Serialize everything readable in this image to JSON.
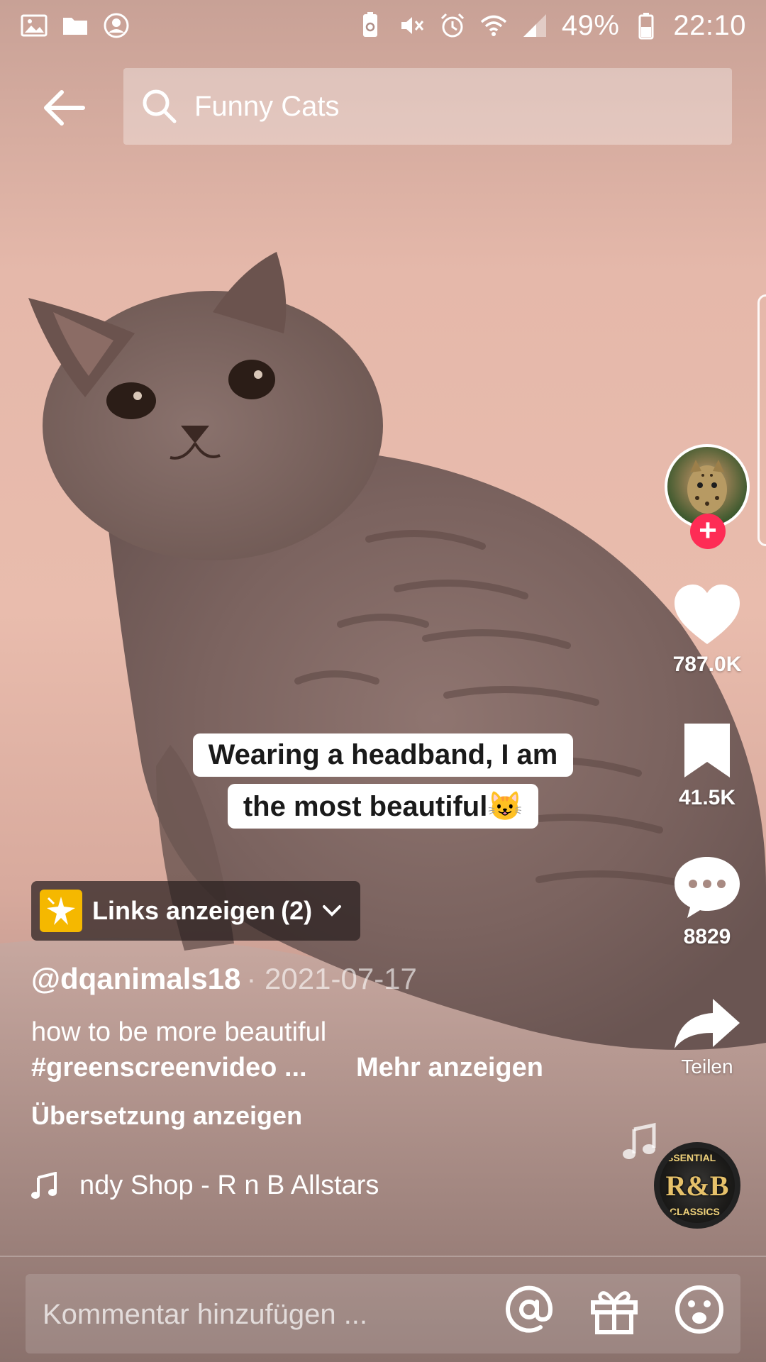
{
  "status_bar": {
    "battery_text": "49%",
    "time": "22:10"
  },
  "search": {
    "query": "Funny Cats"
  },
  "video": {
    "caption_line1": "Wearing a headband, I am",
    "caption_line2": "the most beautiful😺"
  },
  "actions": {
    "likes": "787.0K",
    "saves": "41.5K",
    "comments": "8829",
    "share_label": "Teilen"
  },
  "info": {
    "links_label": "Links anzeigen",
    "links_count": "(2)",
    "author": "@dqanimals18",
    "date": "· 2021-07-17",
    "description": "how to be more beautiful",
    "hashtags": "#greenscreenvideo ...",
    "more": "Mehr anzeigen",
    "translate": "Übersetzung anzeigen",
    "music": "ndy Shop - R n B Allstars",
    "disc_top": "SSENTIAL",
    "disc_main": "R&B",
    "disc_bottom": "CLASSICS"
  },
  "comment_bar": {
    "placeholder": "Kommentar hinzufügen ..."
  },
  "colors": {
    "follow_plus": "#fe2c55",
    "links_badge": "#f5b800"
  }
}
